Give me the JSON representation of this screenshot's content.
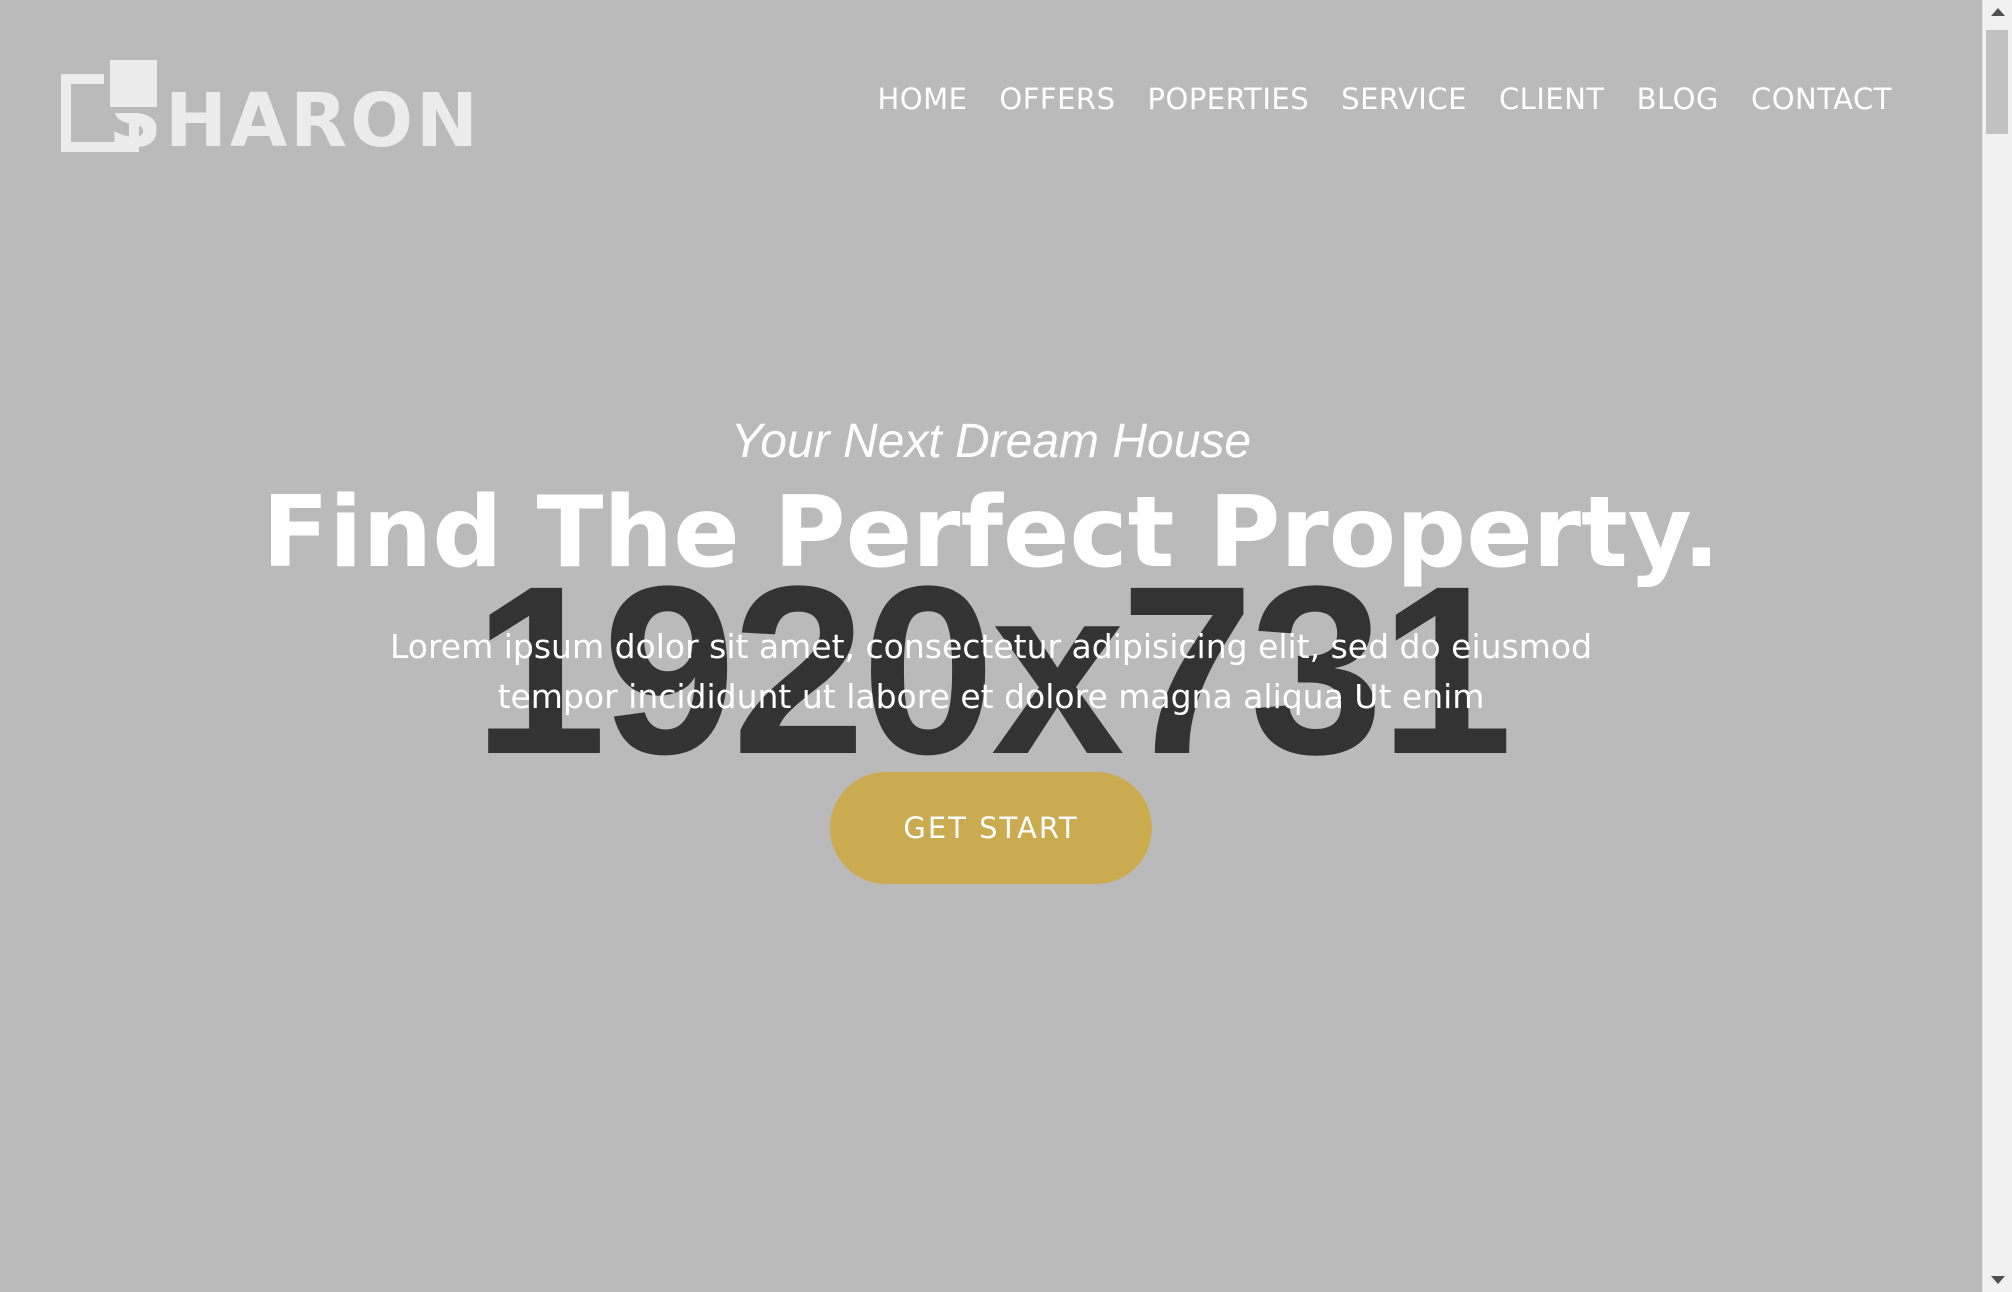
{
  "header": {
    "logo_text": "SHARON",
    "nav": [
      "HOME",
      "OFFERS",
      "POPERTIES",
      "SERVICE",
      "CLIENT",
      "BLOG",
      "CONTACT"
    ]
  },
  "hero": {
    "placeholder_label": "1920x731",
    "subtitle": "Your Next Dream House",
    "title": "Find The Perfect Property.",
    "description": "Lorem ipsum dolor sit amet, consectetur adipisicing elit, sed do eiusmod tempor incididunt ut labore et dolore magna aliqua Ut enim",
    "cta_label": "GET START"
  },
  "colors": {
    "background": "#bababa",
    "accent": "#cbab4f",
    "text": "#ffffff",
    "placeholder_text": "#333333"
  }
}
